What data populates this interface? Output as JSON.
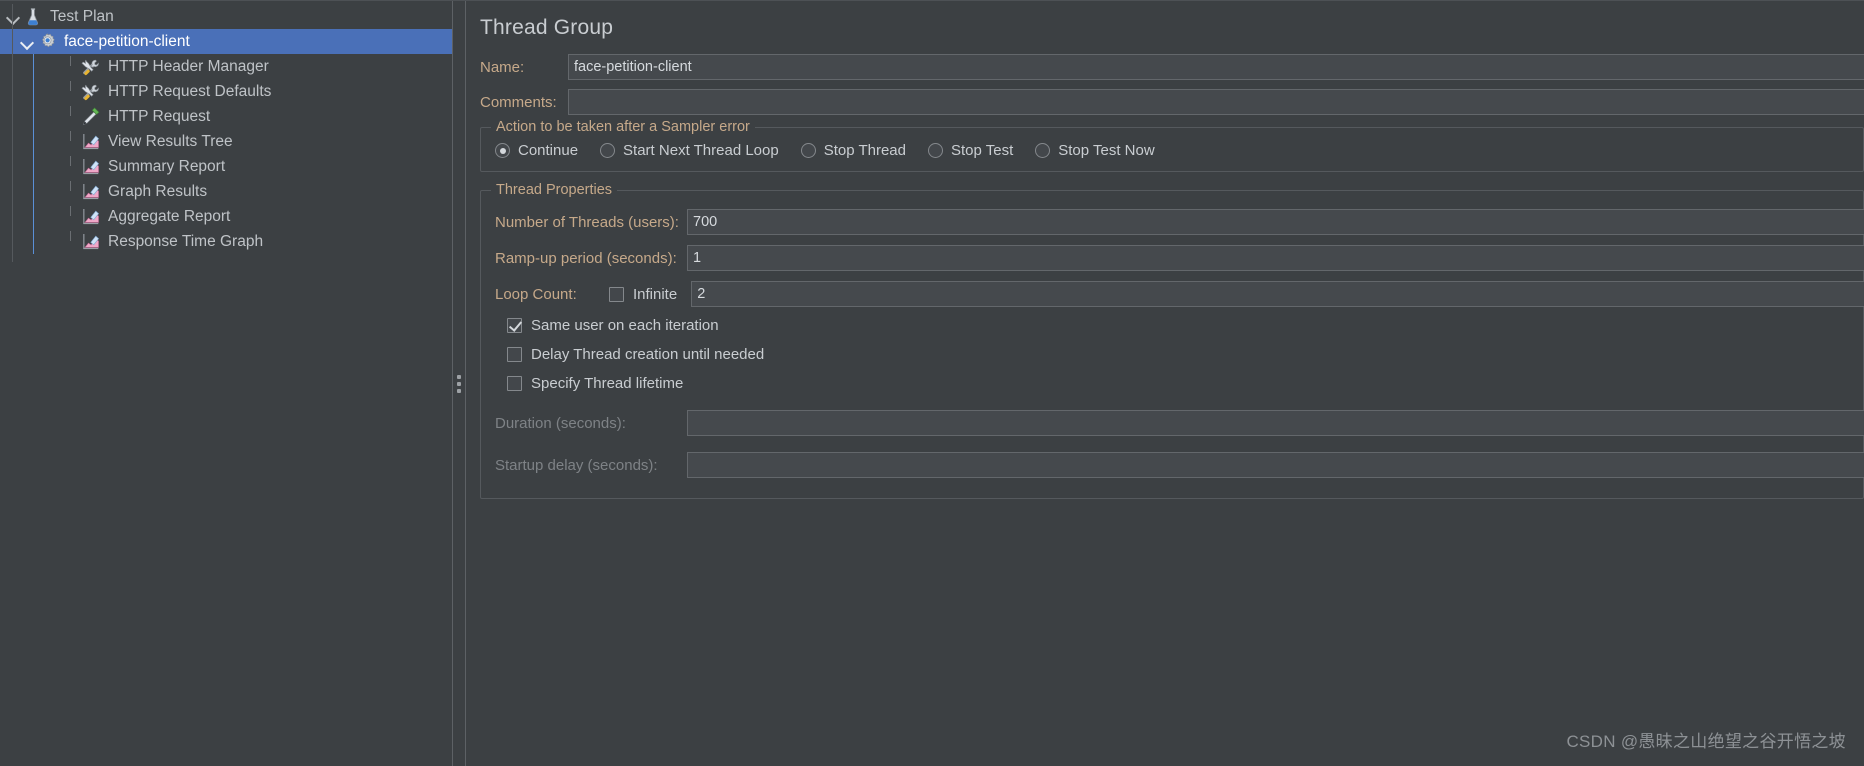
{
  "tree": {
    "items": [
      {
        "label": "Test Plan",
        "icon": "test-plan-icon",
        "depth": 0,
        "twisty": "expanded",
        "selected": false
      },
      {
        "label": "face-petition-client",
        "icon": "thread-group-icon",
        "depth": 1,
        "twisty": "expanded",
        "selected": true
      },
      {
        "label": "HTTP Header Manager",
        "icon": "config-element-icon",
        "depth": 2,
        "twisty": "none",
        "selected": false
      },
      {
        "label": "HTTP Request Defaults",
        "icon": "config-element-icon",
        "depth": 2,
        "twisty": "none",
        "selected": false
      },
      {
        "label": "HTTP Request",
        "icon": "sampler-icon",
        "depth": 2,
        "twisty": "none",
        "selected": false
      },
      {
        "label": "View Results Tree",
        "icon": "listener-icon",
        "depth": 2,
        "twisty": "none",
        "selected": false
      },
      {
        "label": "Summary Report",
        "icon": "listener-icon",
        "depth": 2,
        "twisty": "none",
        "selected": false
      },
      {
        "label": "Graph Results",
        "icon": "listener-icon",
        "depth": 2,
        "twisty": "none",
        "selected": false
      },
      {
        "label": "Aggregate Report",
        "icon": "listener-icon",
        "depth": 2,
        "twisty": "none",
        "selected": false
      },
      {
        "label": "Response Time Graph",
        "icon": "listener-icon",
        "depth": 2,
        "twisty": "none",
        "selected": false
      }
    ]
  },
  "detail": {
    "title": "Thread Group",
    "name": {
      "label": "Name:",
      "value": "face-petition-client"
    },
    "comments": {
      "label": "Comments:",
      "value": ""
    },
    "action_group": {
      "title": "Action to be taken after a Sampler error",
      "options": [
        {
          "label": "Continue",
          "selected": true
        },
        {
          "label": "Start Next Thread Loop",
          "selected": false
        },
        {
          "label": "Stop Thread",
          "selected": false
        },
        {
          "label": "Stop Test",
          "selected": false
        },
        {
          "label": "Stop Test Now",
          "selected": false
        }
      ]
    },
    "thread_properties": {
      "title": "Thread Properties",
      "num_threads": {
        "label": "Number of Threads (users):",
        "value": "700"
      },
      "ramp_up": {
        "label": "Ramp-up period (seconds):",
        "value": "1"
      },
      "loop_count": {
        "label": "Loop Count:",
        "infinite_label": "Infinite",
        "infinite_checked": false,
        "value": "2"
      },
      "checkboxes": [
        {
          "label": "Same user on each iteration",
          "checked": true
        },
        {
          "label": "Delay Thread creation until needed",
          "checked": false
        },
        {
          "label": "Specify Thread lifetime",
          "checked": false
        }
      ],
      "duration": {
        "label": "Duration (seconds):",
        "value": "",
        "disabled": true
      },
      "startup_delay": {
        "label": "Startup delay (seconds):",
        "value": "",
        "disabled": true
      }
    }
  },
  "watermark": "CSDN @愚昧之山绝望之谷开悟之坡",
  "colors": {
    "background": "#3c4043",
    "selection": "#4a70b8",
    "label_accent": "#c6a98a",
    "text": "#c9cdd1",
    "input_bg": "#45494d",
    "border": "#55595d"
  }
}
